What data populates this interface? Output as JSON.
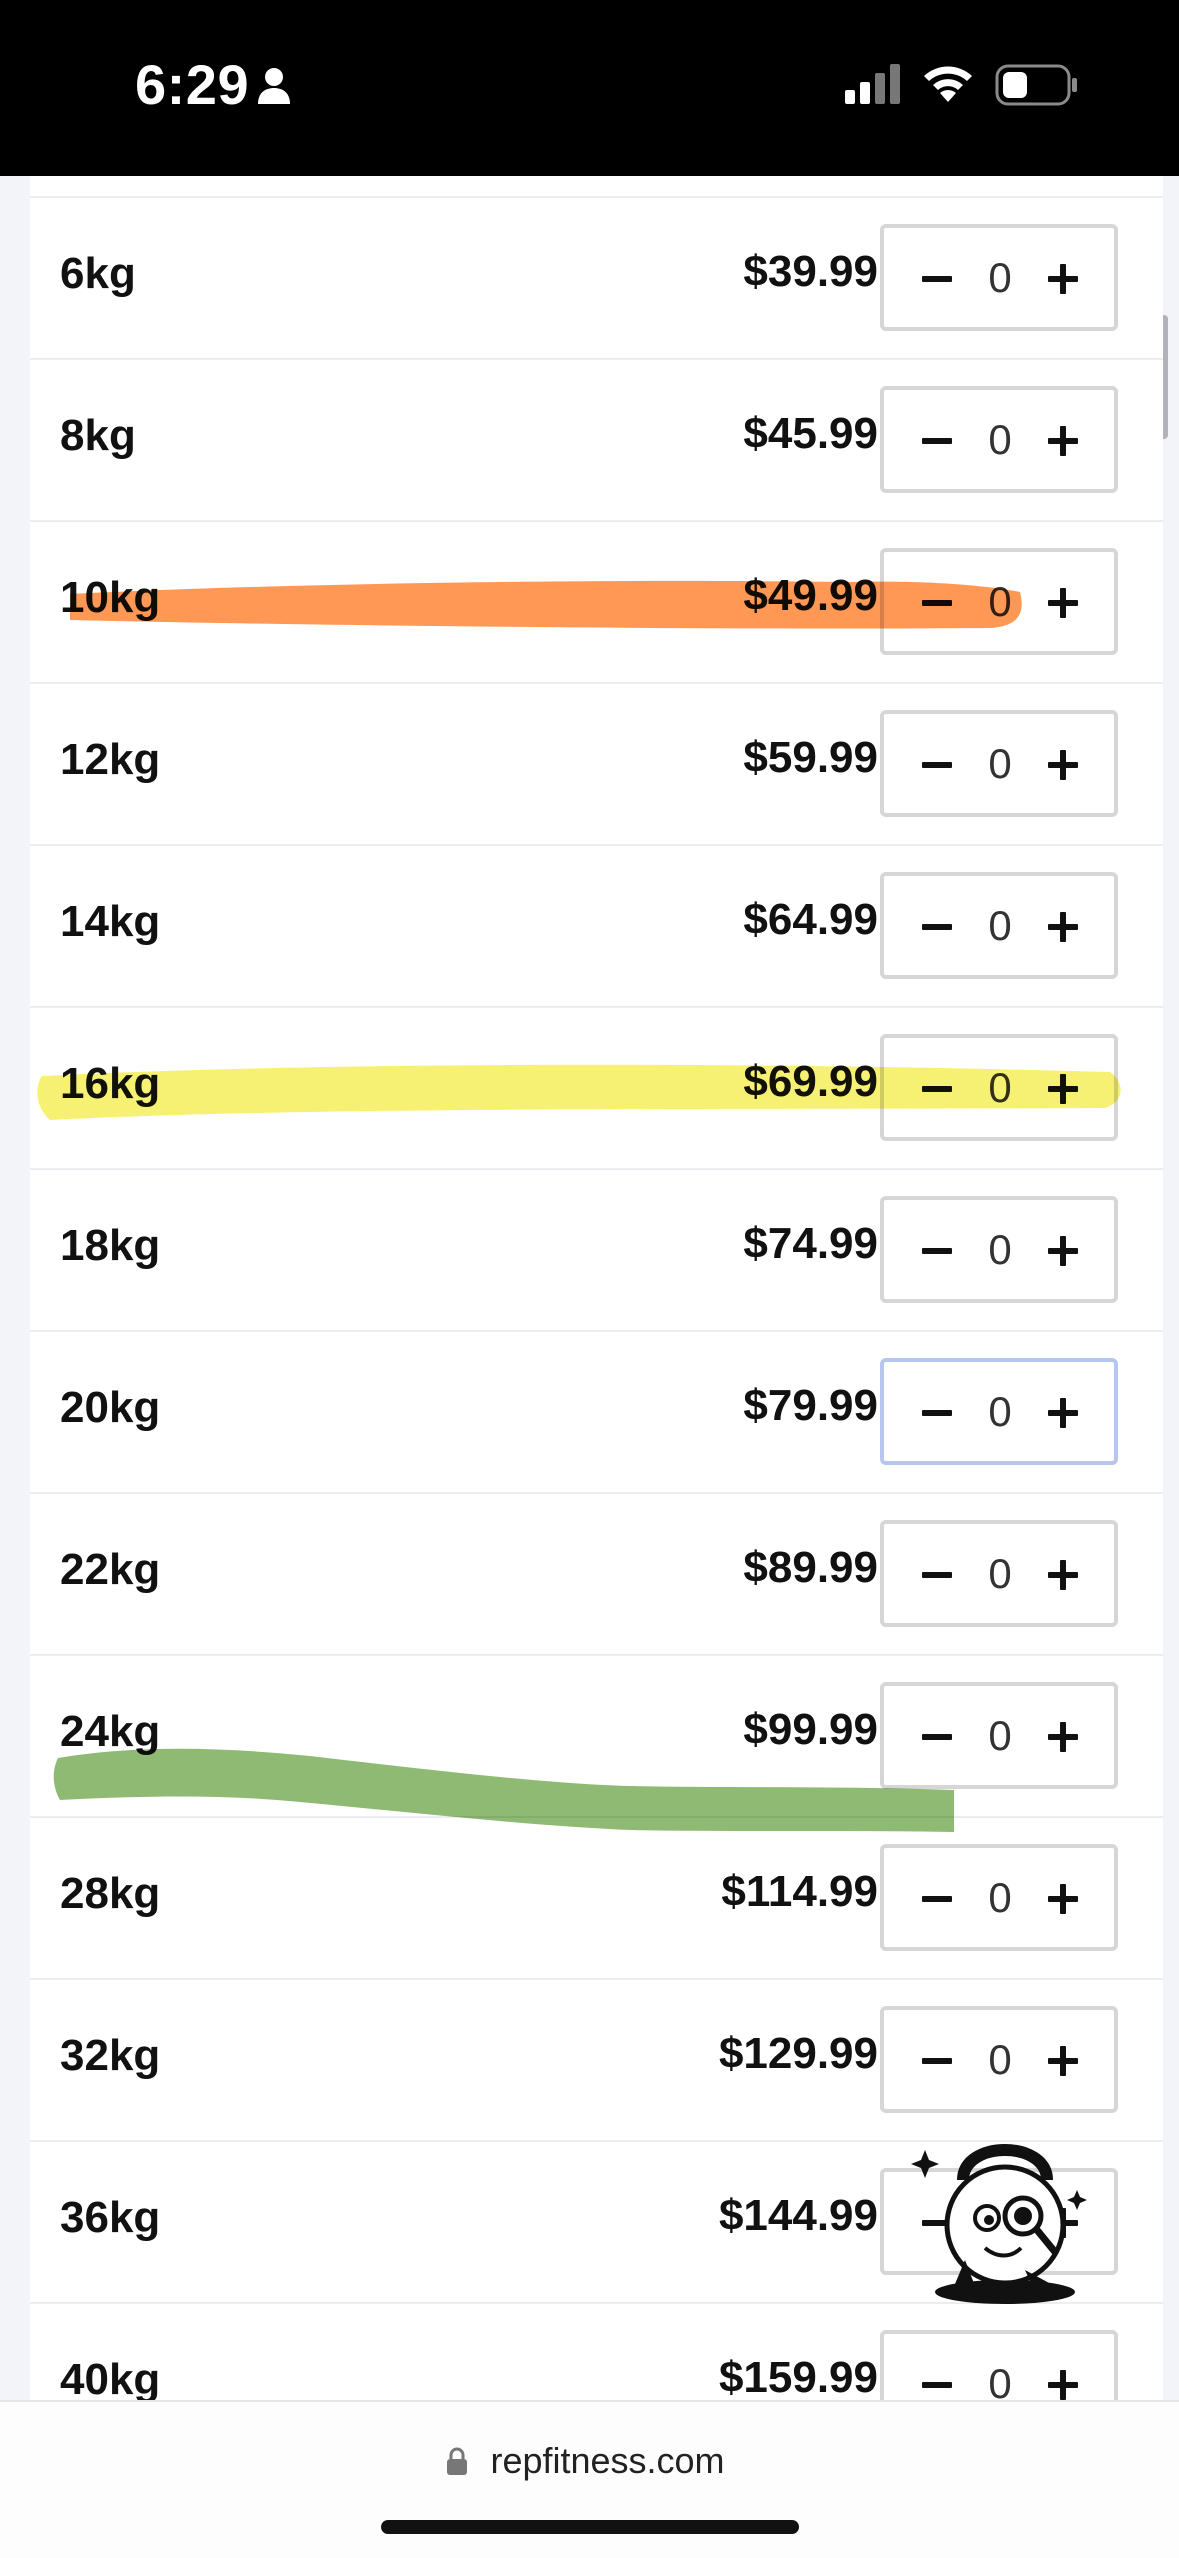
{
  "status_bar": {
    "time": "6:29",
    "icons": [
      "person-icon",
      "signal-icon",
      "wifi-icon",
      "battery-icon"
    ]
  },
  "products": [
    {
      "weight": "6kg",
      "price": "$39.99",
      "qty": "0"
    },
    {
      "weight": "8kg",
      "price": "$45.99",
      "qty": "0"
    },
    {
      "weight": "10kg",
      "price": "$49.99",
      "qty": "0",
      "highlight": "orange"
    },
    {
      "weight": "12kg",
      "price": "$59.99",
      "qty": "0"
    },
    {
      "weight": "14kg",
      "price": "$64.99",
      "qty": "0"
    },
    {
      "weight": "16kg",
      "price": "$69.99",
      "qty": "0",
      "highlight": "yellow"
    },
    {
      "weight": "18kg",
      "price": "$74.99",
      "qty": "0"
    },
    {
      "weight": "20kg",
      "price": "$79.99",
      "qty": "0",
      "focused": true
    },
    {
      "weight": "22kg",
      "price": "$89.99",
      "qty": "0"
    },
    {
      "weight": "24kg",
      "price": "$99.99",
      "qty": "0",
      "highlight": "green"
    },
    {
      "weight": "28kg",
      "price": "$114.99",
      "qty": "0"
    },
    {
      "weight": "32kg",
      "price": "$129.99",
      "qty": "0"
    },
    {
      "weight": "36kg",
      "price": "$144.99",
      "qty": "0"
    },
    {
      "weight": "40kg",
      "price": "$159.99",
      "qty": "0"
    }
  ],
  "highlight_colors": {
    "orange": "#ff8a3d",
    "yellow": "#f8f27a",
    "green": "#7fb45c"
  },
  "address_bar": {
    "domain": "repfitness.com",
    "icon": "lock-icon"
  },
  "mascot": "kettlebell-mascot-icon"
}
